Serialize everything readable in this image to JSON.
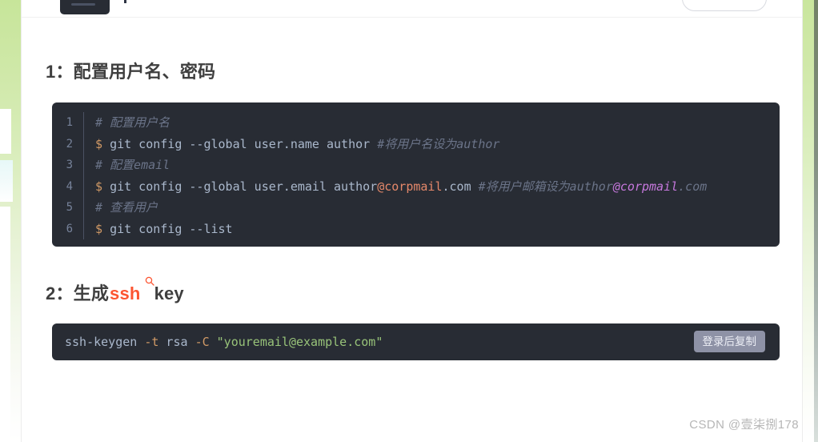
{
  "sections": [
    {
      "number": "1：",
      "title": "配置用户名、密码"
    },
    {
      "number": "2：",
      "prefix": "生成",
      "keyword": "ssh",
      "keyword_icon": "search-icon",
      "suffix": "key"
    }
  ],
  "code_block_numbered": {
    "lines": [
      {
        "n": "1",
        "parts": [
          {
            "type": "comment",
            "text": "# 配置用户名"
          }
        ]
      },
      {
        "n": "2",
        "parts": [
          {
            "type": "prompt",
            "text": "$ "
          },
          {
            "type": "cmd",
            "text": "git config --global user.name author "
          },
          {
            "type": "comment",
            "text": "#将用户名设为author"
          }
        ]
      },
      {
        "n": "3",
        "parts": [
          {
            "type": "comment",
            "text": "# 配置email"
          }
        ]
      },
      {
        "n": "4",
        "parts": [
          {
            "type": "prompt",
            "text": "$ "
          },
          {
            "type": "cmd",
            "text": "git config --global user.email author"
          },
          {
            "type": "at",
            "text": "@corpmail"
          },
          {
            "type": "cmd",
            "text": ".com "
          },
          {
            "type": "comment",
            "text": "#将用户邮箱设为author"
          },
          {
            "type": "at-purple",
            "text": "@corpmail"
          },
          {
            "type": "comment",
            "text": ".com"
          }
        ]
      },
      {
        "n": "5",
        "parts": [
          {
            "type": "comment",
            "text": "# 查看用户"
          }
        ]
      },
      {
        "n": "6",
        "parts": [
          {
            "type": "prompt",
            "text": "$ "
          },
          {
            "type": "cmd",
            "text": "git config --list"
          }
        ]
      }
    ]
  },
  "code_block_plain": {
    "parts": [
      {
        "type": "cmd",
        "text": "ssh-keygen "
      },
      {
        "type": "flag",
        "text": "-t"
      },
      {
        "type": "cmd",
        "text": " rsa "
      },
      {
        "type": "flag",
        "text": "-C"
      },
      {
        "type": "cmd",
        "text": " "
      },
      {
        "type": "str",
        "text": "\"youremail@example.com\""
      }
    ],
    "copy_label": "登录后复制"
  },
  "watermark": "CSDN @壹柒捌178",
  "colors": {
    "code_background": "#282c34",
    "keyword_accent": "#fc5531",
    "heading": "#3f3f3f",
    "line_number": "#76829a",
    "comment": "#6b7489",
    "prompt": "#d19a66",
    "command": "#aab8cc",
    "string": "#98c379",
    "email_highlight": "#c678dd",
    "copy_button": "#8e92a6",
    "rail_green": "#c7e59a"
  }
}
